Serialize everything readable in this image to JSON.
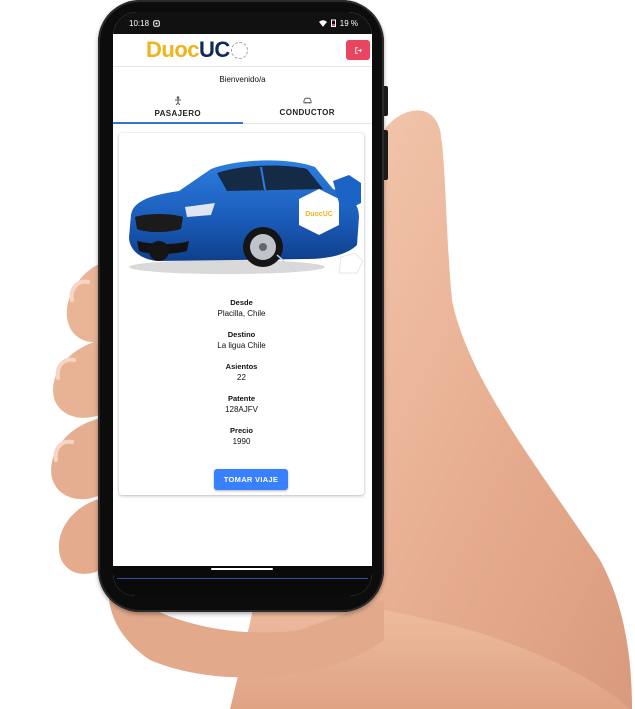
{
  "status_bar": {
    "time": "10:18",
    "battery": "19 %"
  },
  "header": {
    "logo_text_1": "Duoc",
    "logo_text_2": "UC",
    "logout_icon": "logout-icon"
  },
  "welcome": "Bienvenido/a",
  "tabs": [
    {
      "label": "PASAJERO",
      "icon": "person-icon",
      "active": true
    },
    {
      "label": "CONDUCTOR",
      "icon": "car-icon",
      "active": false
    }
  ],
  "trip": {
    "image_badge": "DuocUC",
    "fields": [
      {
        "label": "Desde",
        "value": "Placilla, Chile"
      },
      {
        "label": "Destino",
        "value": "La ligua Chile"
      },
      {
        "label": "Asientos",
        "value": "22"
      },
      {
        "label": "Patente",
        "value": "128AJFV"
      },
      {
        "label": "Precio",
        "value": "1990"
      }
    ],
    "button_label": "TOMAR VIAJE"
  },
  "colors": {
    "primary": "#3880ff",
    "tab_indicator": "#3b6fd8",
    "logout": "#e9455f",
    "duoc_yellow": "#f1b31c",
    "uc_navy": "#0d2a5a",
    "car_blue": "#1b63c4"
  }
}
